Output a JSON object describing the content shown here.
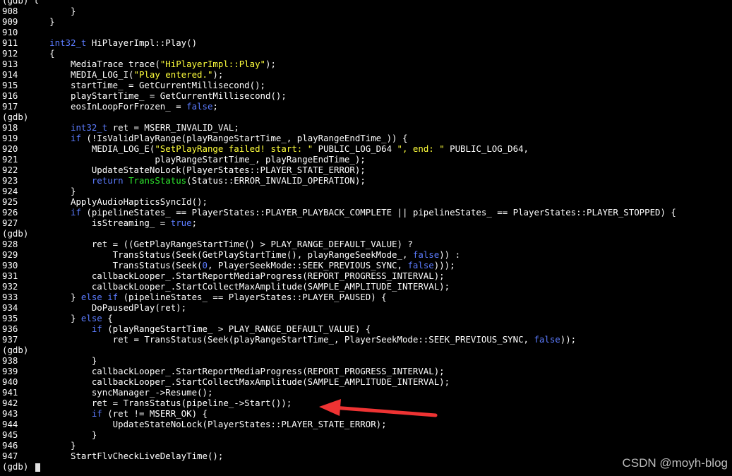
{
  "app": {
    "name": "gdb"
  },
  "colors": {
    "background": "#000000",
    "text": "#ffffff",
    "keyword": "#5c7cff",
    "string": "#ffff3c",
    "type_highlight": "#2ee82e",
    "arrow": "#ee3333",
    "watermark": "#bcbcbc"
  },
  "terminal": {
    "lines": [
      {
        "kind": "prompt",
        "text": "(gdb) l"
      },
      {
        "kind": "code",
        "num": "908",
        "segments": [
          {
            "t": "        }",
            "c": "plain"
          }
        ]
      },
      {
        "kind": "code",
        "num": "909",
        "segments": [
          {
            "t": "    }",
            "c": "plain"
          }
        ]
      },
      {
        "kind": "code",
        "num": "910",
        "segments": []
      },
      {
        "kind": "code",
        "num": "911",
        "segments": [
          {
            "t": "    ",
            "c": "plain"
          },
          {
            "t": "int32_t",
            "c": "kw"
          },
          {
            "t": " HiPlayerImpl::Play()",
            "c": "plain"
          }
        ]
      },
      {
        "kind": "code",
        "num": "912",
        "segments": [
          {
            "t": "    {",
            "c": "plain"
          }
        ]
      },
      {
        "kind": "code",
        "num": "913",
        "segments": [
          {
            "t": "        MediaTrace trace(",
            "c": "plain"
          },
          {
            "t": "\"HiPlayerImpl::Play\"",
            "c": "str"
          },
          {
            "t": ");",
            "c": "plain"
          }
        ]
      },
      {
        "kind": "code",
        "num": "914",
        "segments": [
          {
            "t": "        MEDIA_LOG_I(",
            "c": "plain"
          },
          {
            "t": "\"Play entered.\"",
            "c": "str"
          },
          {
            "t": ");",
            "c": "plain"
          }
        ]
      },
      {
        "kind": "code",
        "num": "915",
        "segments": [
          {
            "t": "        startTime_ = GetCurrentMillisecond();",
            "c": "plain"
          }
        ]
      },
      {
        "kind": "code",
        "num": "916",
        "segments": [
          {
            "t": "        playStartTime_ = GetCurrentMillisecond();",
            "c": "plain"
          }
        ]
      },
      {
        "kind": "code",
        "num": "917",
        "segments": [
          {
            "t": "        eosInLoopForFrozen_ = ",
            "c": "plain"
          },
          {
            "t": "false",
            "c": "kw"
          },
          {
            "t": ";",
            "c": "plain"
          }
        ]
      },
      {
        "kind": "prompt",
        "text": "(gdb)"
      },
      {
        "kind": "code",
        "num": "918",
        "segments": [
          {
            "t": "        ",
            "c": "plain"
          },
          {
            "t": "int32_t",
            "c": "kw"
          },
          {
            "t": " ret = MSERR_INVALID_VAL;",
            "c": "plain"
          }
        ]
      },
      {
        "kind": "code",
        "num": "919",
        "segments": [
          {
            "t": "        ",
            "c": "plain"
          },
          {
            "t": "if",
            "c": "kw"
          },
          {
            "t": " (!IsValidPlayRange(playRangeStartTime_, playRangeEndTime_)) {",
            "c": "plain"
          }
        ]
      },
      {
        "kind": "code",
        "num": "920",
        "segments": [
          {
            "t": "            MEDIA_LOG_E(",
            "c": "plain"
          },
          {
            "t": "\"SetPlayRange failed! start: \"",
            "c": "str"
          },
          {
            "t": " PUBLIC_LOG_D64 ",
            "c": "plain"
          },
          {
            "t": "\", end: \"",
            "c": "str"
          },
          {
            "t": " PUBLIC_LOG_D64,",
            "c": "plain"
          }
        ]
      },
      {
        "kind": "code",
        "num": "921",
        "segments": [
          {
            "t": "                        playRangeStartTime_, playRangeEndTime_);",
            "c": "plain"
          }
        ]
      },
      {
        "kind": "code",
        "num": "922",
        "segments": [
          {
            "t": "            UpdateStateNoLock(PlayerStates::PLAYER_STATE_ERROR);",
            "c": "plain"
          }
        ]
      },
      {
        "kind": "code",
        "num": "923",
        "segments": [
          {
            "t": "            ",
            "c": "plain"
          },
          {
            "t": "return",
            "c": "kw"
          },
          {
            "t": " ",
            "c": "plain"
          },
          {
            "t": "TransStatus",
            "c": "fn"
          },
          {
            "t": "(Status::ERROR_INVALID_OPERATION);",
            "c": "plain"
          }
        ]
      },
      {
        "kind": "code",
        "num": "924",
        "segments": [
          {
            "t": "        }",
            "c": "plain"
          }
        ]
      },
      {
        "kind": "code",
        "num": "925",
        "segments": [
          {
            "t": "        ApplyAudioHapticsSyncId();",
            "c": "plain"
          }
        ]
      },
      {
        "kind": "code",
        "num": "926",
        "segments": [
          {
            "t": "        ",
            "c": "plain"
          },
          {
            "t": "if",
            "c": "kw"
          },
          {
            "t": " (pipelineStates_ == PlayerStates::PLAYER_PLAYBACK_COMPLETE || pipelineStates_ == PlayerStates::PLAYER_STOPPED) {",
            "c": "plain"
          }
        ]
      },
      {
        "kind": "code",
        "num": "927",
        "segments": [
          {
            "t": "            isStreaming_ = ",
            "c": "plain"
          },
          {
            "t": "true",
            "c": "kw"
          },
          {
            "t": ";",
            "c": "plain"
          }
        ]
      },
      {
        "kind": "prompt",
        "text": "(gdb)"
      },
      {
        "kind": "code",
        "num": "928",
        "segments": [
          {
            "t": "            ret = ((GetPlayRangeStartTime() > PLAY_RANGE_DEFAULT_VALUE) ?",
            "c": "plain"
          }
        ]
      },
      {
        "kind": "code",
        "num": "929",
        "segments": [
          {
            "t": "                TransStatus(Seek(GetPlayStartTime(), playRangeSeekMode_, ",
            "c": "plain"
          },
          {
            "t": "false",
            "c": "kw"
          },
          {
            "t": ")) :",
            "c": "plain"
          }
        ]
      },
      {
        "kind": "code",
        "num": "930",
        "segments": [
          {
            "t": "                TransStatus(Seek(",
            "c": "plain"
          },
          {
            "t": "0",
            "c": "kw"
          },
          {
            "t": ", PlayerSeekMode::SEEK_PREVIOUS_SYNC, ",
            "c": "plain"
          },
          {
            "t": "false",
            "c": "kw"
          },
          {
            "t": ")));",
            "c": "plain"
          }
        ]
      },
      {
        "kind": "code",
        "num": "931",
        "segments": [
          {
            "t": "            callbackLooper_.StartReportMediaProgress(REPORT_PROGRESS_INTERVAL);",
            "c": "plain"
          }
        ]
      },
      {
        "kind": "code",
        "num": "932",
        "segments": [
          {
            "t": "            callbackLooper_.StartCollectMaxAmplitude(SAMPLE_AMPLITUDE_INTERVAL);",
            "c": "plain"
          }
        ]
      },
      {
        "kind": "code",
        "num": "933",
        "segments": [
          {
            "t": "        } ",
            "c": "plain"
          },
          {
            "t": "else if",
            "c": "kw"
          },
          {
            "t": " (pipelineStates_ == PlayerStates::PLAYER_PAUSED) {",
            "c": "plain"
          }
        ]
      },
      {
        "kind": "code",
        "num": "934",
        "segments": [
          {
            "t": "            DoPausedPlay(ret);",
            "c": "plain"
          }
        ]
      },
      {
        "kind": "code",
        "num": "935",
        "segments": [
          {
            "t": "        } ",
            "c": "plain"
          },
          {
            "t": "else",
            "c": "kw"
          },
          {
            "t": " {",
            "c": "plain"
          }
        ]
      },
      {
        "kind": "code",
        "num": "936",
        "segments": [
          {
            "t": "            ",
            "c": "plain"
          },
          {
            "t": "if",
            "c": "kw"
          },
          {
            "t": " (playRangeStartTime_ > PLAY_RANGE_DEFAULT_VALUE) {",
            "c": "plain"
          }
        ]
      },
      {
        "kind": "code",
        "num": "937",
        "segments": [
          {
            "t": "                ret = TransStatus(Seek(playRangeStartTime_, PlayerSeekMode::SEEK_PREVIOUS_SYNC, ",
            "c": "plain"
          },
          {
            "t": "false",
            "c": "kw"
          },
          {
            "t": "));",
            "c": "plain"
          }
        ]
      },
      {
        "kind": "prompt",
        "text": "(gdb)"
      },
      {
        "kind": "code",
        "num": "938",
        "segments": [
          {
            "t": "            }",
            "c": "plain"
          }
        ]
      },
      {
        "kind": "code",
        "num": "939",
        "segments": [
          {
            "t": "            callbackLooper_.StartReportMediaProgress(REPORT_PROGRESS_INTERVAL);",
            "c": "plain"
          }
        ]
      },
      {
        "kind": "code",
        "num": "940",
        "segments": [
          {
            "t": "            callbackLooper_.StartCollectMaxAmplitude(SAMPLE_AMPLITUDE_INTERVAL);",
            "c": "plain"
          }
        ]
      },
      {
        "kind": "code",
        "num": "941",
        "segments": [
          {
            "t": "            syncManager_->Resume();",
            "c": "plain"
          }
        ]
      },
      {
        "kind": "code",
        "num": "942",
        "segments": [
          {
            "t": "            ret = TransStatus(pipeline_->Start());",
            "c": "plain"
          }
        ]
      },
      {
        "kind": "code",
        "num": "943",
        "segments": [
          {
            "t": "            ",
            "c": "plain"
          },
          {
            "t": "if",
            "c": "kw"
          },
          {
            "t": " (ret != MSERR_OK) {",
            "c": "plain"
          }
        ]
      },
      {
        "kind": "code",
        "num": "944",
        "segments": [
          {
            "t": "                UpdateStateNoLock(PlayerStates::PLAYER_STATE_ERROR);",
            "c": "plain"
          }
        ]
      },
      {
        "kind": "code",
        "num": "945",
        "segments": [
          {
            "t": "            }",
            "c": "plain"
          }
        ]
      },
      {
        "kind": "code",
        "num": "946",
        "segments": [
          {
            "t": "        }",
            "c": "plain"
          }
        ]
      },
      {
        "kind": "code",
        "num": "947",
        "segments": [
          {
            "t": "        StartFlvCheckLiveDelayTime();",
            "c": "plain"
          }
        ]
      },
      {
        "kind": "prompt",
        "text": "(gdb)",
        "cursor": true
      }
    ]
  },
  "watermark": {
    "text": "CSDN @moyh-blog"
  }
}
